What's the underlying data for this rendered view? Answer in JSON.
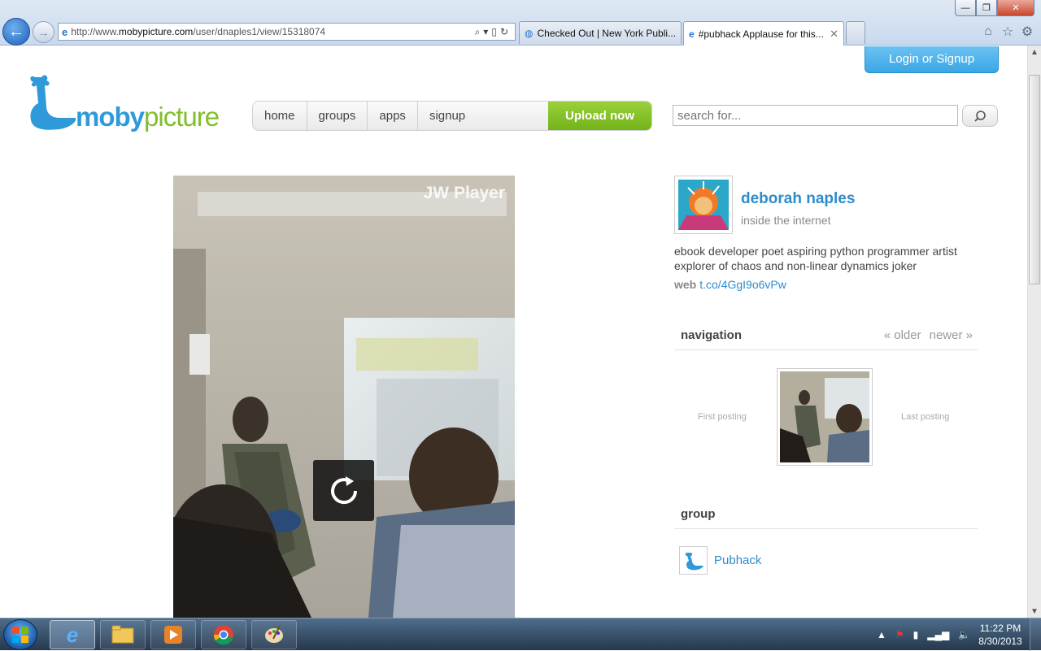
{
  "browser": {
    "address": {
      "prefix": "http://www.",
      "domain": "mobypicture.com",
      "path": "/user/dnaples1/view/15318074"
    },
    "tabs": [
      {
        "label": "Checked Out | New York Publi..."
      },
      {
        "label": "#pubhack Applause for this...",
        "close": "✕"
      }
    ],
    "window_controls": {
      "minimize": "—",
      "maximize": "❐",
      "close": "✕"
    }
  },
  "site": {
    "login_label": "Login or Signup",
    "logo": {
      "part1": "moby",
      "part2": "picture"
    },
    "nav": [
      "home",
      "groups",
      "apps",
      "signup"
    ],
    "upload_label": "Upload now",
    "search_placeholder": "search for...",
    "colors": {
      "brand_blue": "#2f9ad9",
      "brand_green": "#7fbf2a",
      "link": "#2d8ccc"
    }
  },
  "media": {
    "watermark": "JW Player",
    "replay_icon": "replay-icon"
  },
  "profile": {
    "name": "deborah naples",
    "location": "inside the internet",
    "bio": "ebook developer poet aspiring python programmer artist explorer of chaos and non-linear dynamics joker",
    "web_label": "web",
    "web_link": "t.co/4GgI9o6vPw"
  },
  "navigation": {
    "title": "navigation",
    "older": "« older",
    "newer": "newer »",
    "first": "First posting",
    "last": "Last posting"
  },
  "group": {
    "title": "group",
    "name": "Pubhack"
  },
  "taskbar": {
    "time": "11:22 PM",
    "date": "8/30/2013"
  }
}
